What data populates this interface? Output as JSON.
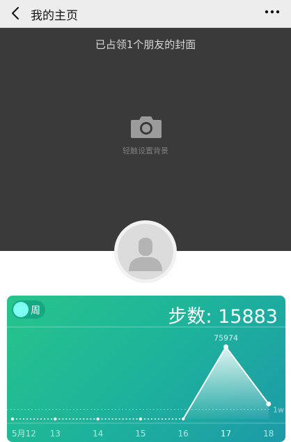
{
  "navbar": {
    "title": "我的主页",
    "back_icon": "chevron-left-icon",
    "more_icon": "more-dots-icon"
  },
  "cover": {
    "caption": "已占领1个朋友的封面",
    "hint": "轻触设置背景",
    "icon": "camera-icon"
  },
  "avatar": {
    "icon": "default-user-icon"
  },
  "card": {
    "toggle_label": "周",
    "steps_label": "步数:",
    "steps_value": "15883",
    "colors": {
      "start": "#27c48a",
      "end": "#1d9aa8",
      "toggle_knob": "#7ffff2"
    }
  },
  "chart_data": {
    "type": "area",
    "categories": [
      "5月12",
      "13",
      "14",
      "15",
      "16",
      "17",
      "18"
    ],
    "values": [
      0,
      0,
      0,
      0,
      0,
      75974,
      15883
    ],
    "data_labels": [
      {
        "category": "17",
        "text": "75974"
      }
    ],
    "reference_line": {
      "label": "1w",
      "value": 10000
    },
    "highlighted_category": "17",
    "ylim": [
      0,
      80000
    ]
  }
}
